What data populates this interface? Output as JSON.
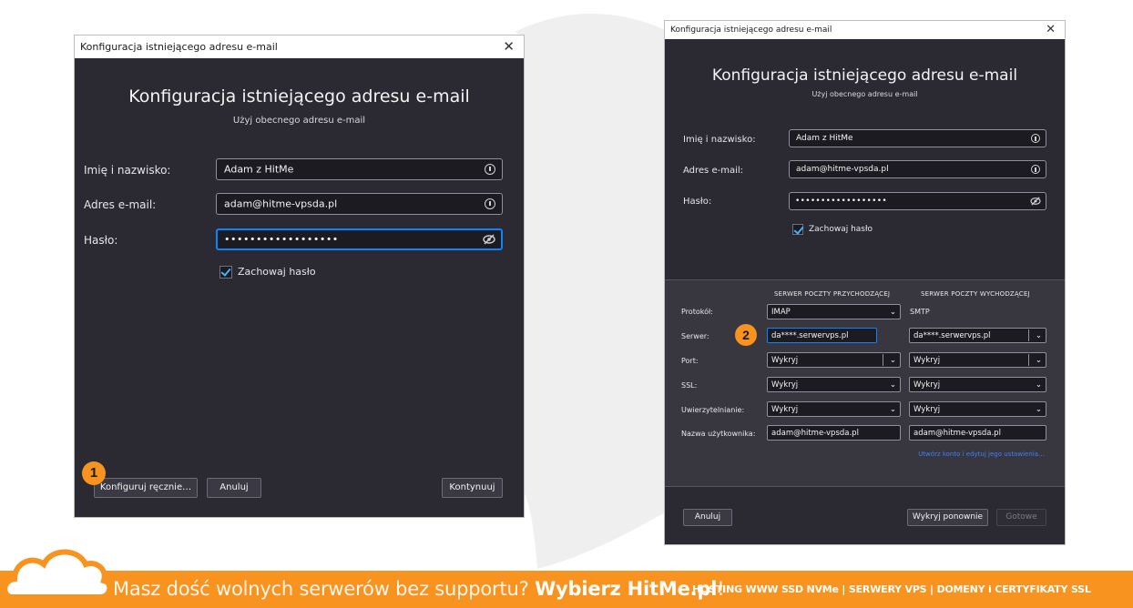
{
  "colors": {
    "accent": "#0a84ff",
    "badge": "#f7931e",
    "window_bg": "#2b2a33",
    "footer": "#f7931e"
  },
  "left_window": {
    "title": "Konfiguracja istniejącego adresu e-mail",
    "close": "✕",
    "heading": "Konfiguracja istniejącego adresu e-mail",
    "subheading": "Użyj obecnego adresu e-mail",
    "name_label": "Imię i nazwisko:",
    "name_value": "Adam z HitMe",
    "email_label": "Adres e-mail:",
    "email_value": "adam@hitme-vpsda.pl",
    "password_label": "Hasło:",
    "password_value": "••••••••••••••••••",
    "remember_label": "Zachowaj hasło",
    "manual_button": "Konfiguruj ręcznie…",
    "cancel_button": "Anuluj",
    "continue_button": "Kontynuuj",
    "badge": "1"
  },
  "right_window": {
    "title": "Konfiguracja istniejącego adresu e-mail",
    "close": "✕",
    "heading": "Konfiguracja istniejącego adresu e-mail",
    "subheading": "Użyj obecnego adresu e-mail",
    "name_label": "Imię i nazwisko:",
    "name_value": "Adam z HitMe",
    "email_label": "Adres e-mail:",
    "email_value": "adam@hitme-vpsda.pl",
    "password_label": "Hasło:",
    "password_value": "••••••••••••••••••",
    "remember_label": "Zachowaj hasło",
    "incoming_header": "SERWER POCZTY PRZYCHODZĄCEJ",
    "outgoing_header": "SERWER POCZTY WYCHODZĄCEJ",
    "protocol_label": "Protokół:",
    "protocol_in": "IMAP",
    "protocol_out": "SMTP",
    "server_label": "Serwer:",
    "server_in": "da****.serwervps.pl",
    "server_out": "da****.serwervps.pl",
    "port_label": "Port:",
    "port_in": "Wykryj",
    "port_out": "Wykryj",
    "ssl_label": "SSL:",
    "ssl_in": "Wykryj",
    "ssl_out": "Wykryj",
    "auth_label": "Uwierzytelnianie:",
    "auth_in": "Wykryj",
    "auth_out": "Wykryj",
    "username_label": "Nazwa użytkownika:",
    "username_in": "adam@hitme-vpsda.pl",
    "username_out": "adam@hitme-vpsda.pl",
    "link_text": "Utwórz konto i edytuj jego ustawienia…",
    "cancel_button": "Anuluj",
    "redetect_button": "Wykryj ponownie",
    "done_button": "Gotowe",
    "badge": "2"
  },
  "footer": {
    "slogan_prefix": "Masz dość wolnych serwerów bez supportu? ",
    "slogan_brand": "Wybierz HitMe.pl",
    "slogan_suffix": "!",
    "tagline": "HOSTING WWW SSD NVMe | SERWERY VPS | DOMENY i CERTYFIKATY SSL"
  }
}
